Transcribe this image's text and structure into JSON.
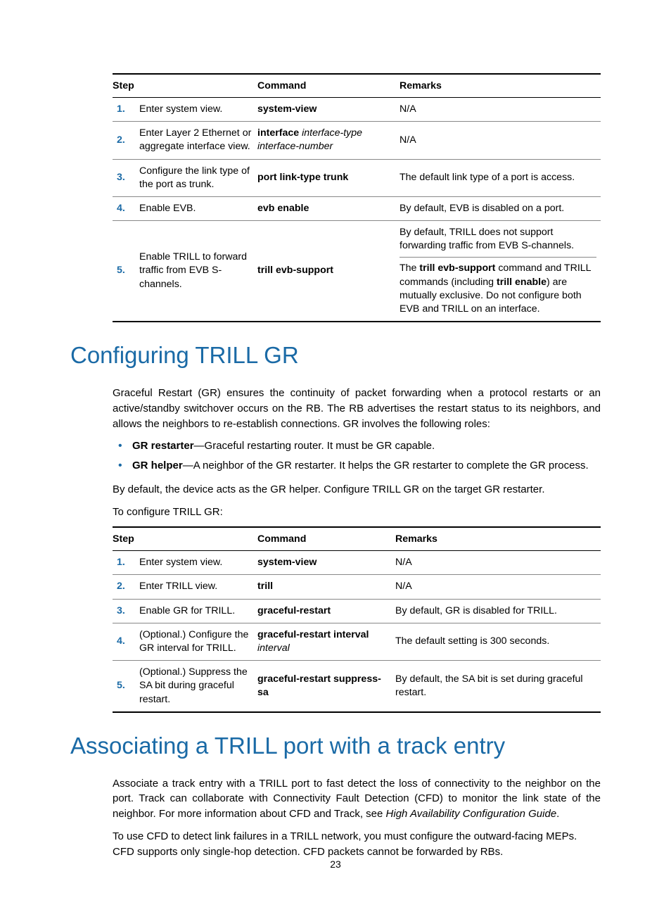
{
  "page_number": "23",
  "table1": {
    "headers": {
      "step": "Step",
      "command": "Command",
      "remarks": "Remarks"
    },
    "rows": [
      {
        "n": "1.",
        "step": "Enter system view.",
        "cmd_b": "system-view",
        "cmd_i": "",
        "rem": "N/A"
      },
      {
        "n": "2.",
        "step": "Enter Layer 2 Ethernet or aggregate interface view.",
        "cmd_b": "interface",
        "cmd_i": " interface-type interface-number",
        "rem": "N/A"
      },
      {
        "n": "3.",
        "step": "Configure the link type of the port as trunk.",
        "cmd_b": "port link-type trunk",
        "cmd_i": "",
        "rem": "The default link type of a port is access."
      },
      {
        "n": "4.",
        "step": "Enable EVB.",
        "cmd_b": "evb enable",
        "cmd_i": "",
        "rem": "By default, EVB is disabled on a port."
      },
      {
        "n": "5.",
        "step": "Enable TRILL to forward traffic from EVB S-channels.",
        "cmd_b": "trill evb-support",
        "cmd_i": "",
        "rem_a": "By default, TRILL does not support forwarding traffic from EVB S-channels.",
        "rem_b1": "The ",
        "rem_b2": "trill evb-support",
        "rem_b3": " command and TRILL commands (including ",
        "rem_b4": "trill enable",
        "rem_b5": ") are mutually exclusive. Do not configure both EVB and TRILL on an interface."
      }
    ]
  },
  "section1": {
    "heading": "Configuring TRILL GR",
    "para1": "Graceful Restart (GR) ensures the continuity of packet forwarding when a protocol restarts or an active/standby switchover occurs on the RB. The RB advertises the restart status to its neighbors, and allows the neighbors to re-establish connections. GR involves the following roles:",
    "bullets": [
      {
        "b": "GR restarter",
        "t": "—Graceful restarting router. It must be GR capable."
      },
      {
        "b": "GR helper",
        "t": "—A neighbor of the GR restarter. It helps the GR restarter to complete the GR process."
      }
    ],
    "para2": "By default, the device acts as the GR helper. Configure TRILL GR on the target GR restarter.",
    "para3": "To configure TRILL GR:"
  },
  "table2": {
    "headers": {
      "step": "Step",
      "command": "Command",
      "remarks": "Remarks"
    },
    "rows": [
      {
        "n": "1.",
        "step": "Enter system view.",
        "cmd_b": "system-view",
        "cmd_i": "",
        "rem": "N/A"
      },
      {
        "n": "2.",
        "step": "Enter TRILL view.",
        "cmd_b": "trill",
        "cmd_i": "",
        "rem": "N/A"
      },
      {
        "n": "3.",
        "step": "Enable GR for TRILL.",
        "cmd_b": "graceful-restart",
        "cmd_i": "",
        "rem": "By default, GR is disabled for TRILL."
      },
      {
        "n": "4.",
        "step": "(Optional.) Configure the GR interval for TRILL.",
        "cmd_b": "graceful-restart interval",
        "cmd_i": " interval",
        "rem": "The default setting is 300 seconds."
      },
      {
        "n": "5.",
        "step": "(Optional.) Suppress the SA bit during graceful restart.",
        "cmd_b": "graceful-restart suppress-sa",
        "cmd_i": "",
        "rem": "By default, the SA bit is set during graceful restart."
      }
    ]
  },
  "section2": {
    "heading": "Associating a TRILL port with a track entry",
    "para1a": "Associate a track entry with a TRILL port to fast detect the loss of connectivity to the neighbor on the port. Track can collaborate with Connectivity Fault Detection (CFD) to monitor the link state of the neighbor. For more information about CFD and Track, see ",
    "para1b": "High Availability Configuration Guide",
    "para1c": ".",
    "para2": "To use CFD to detect link failures in a TRILL network, you must configure the outward-facing MEPs. CFD supports only single-hop detection. CFD packets cannot be forwarded by RBs."
  }
}
